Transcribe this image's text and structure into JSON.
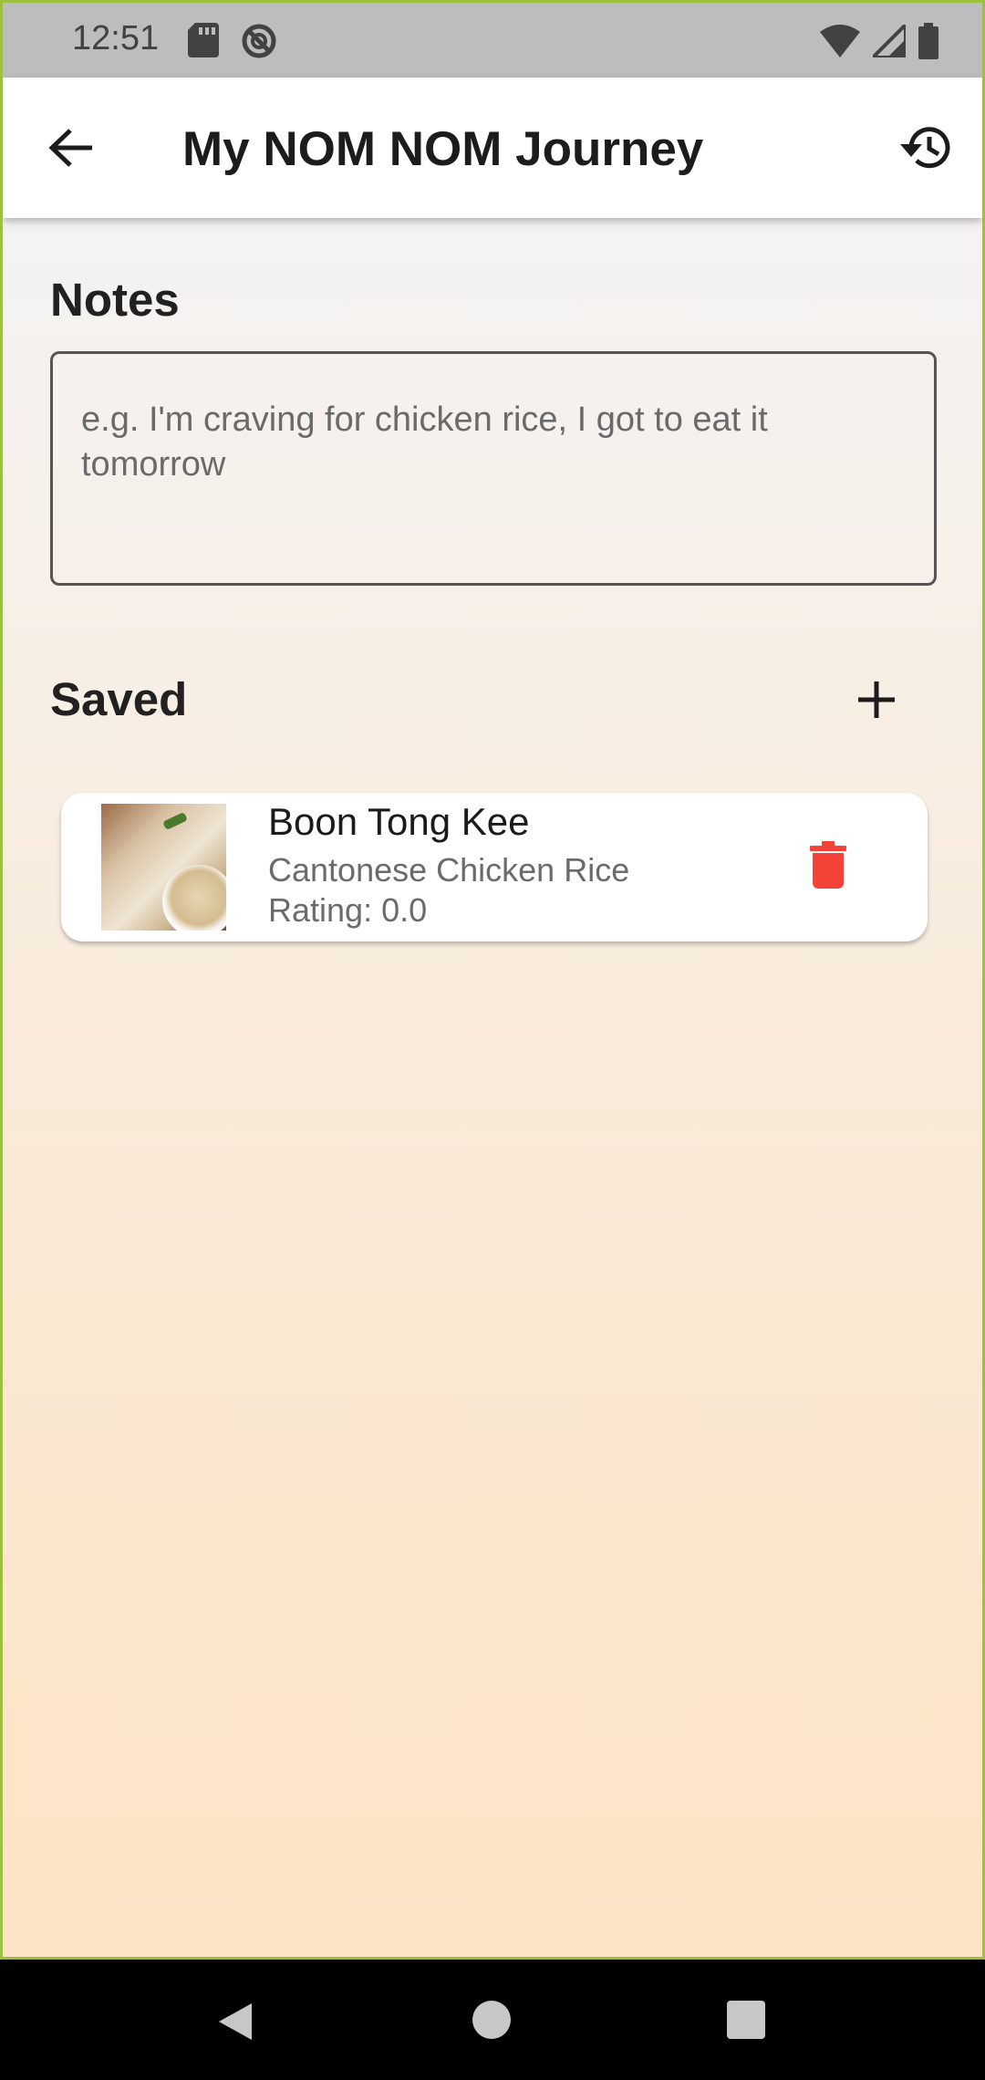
{
  "status_bar": {
    "time": "12:51",
    "left_icons": [
      "sd-card-icon",
      "do-not-disturb-icon"
    ],
    "right_icons": [
      "wifi-icon",
      "signal-icon",
      "battery-icon"
    ]
  },
  "app_bar": {
    "title": "My NOM NOM Journey",
    "back_icon": "arrow-back-icon",
    "history_icon": "history-icon"
  },
  "notes": {
    "title": "Notes",
    "value": "",
    "placeholder": "e.g. I'm craving for chicken rice, I got to eat it tomorrow"
  },
  "saved": {
    "title": "Saved",
    "add_icon": "plus-icon",
    "items": [
      {
        "name": "Boon Tong Kee",
        "cuisine": "Cantonese Chicken Rice",
        "rating": "Rating: 0.0",
        "delete_icon": "trash-icon"
      }
    ]
  },
  "colors": {
    "delete": "#f44336",
    "gradient_top": "#f4f3f2",
    "gradient_bottom": "#fde4c4",
    "status_bar": "#bdbdbd"
  },
  "nav_bar": {
    "icons": [
      "nav-back-icon",
      "nav-home-icon",
      "nav-recents-icon"
    ]
  }
}
